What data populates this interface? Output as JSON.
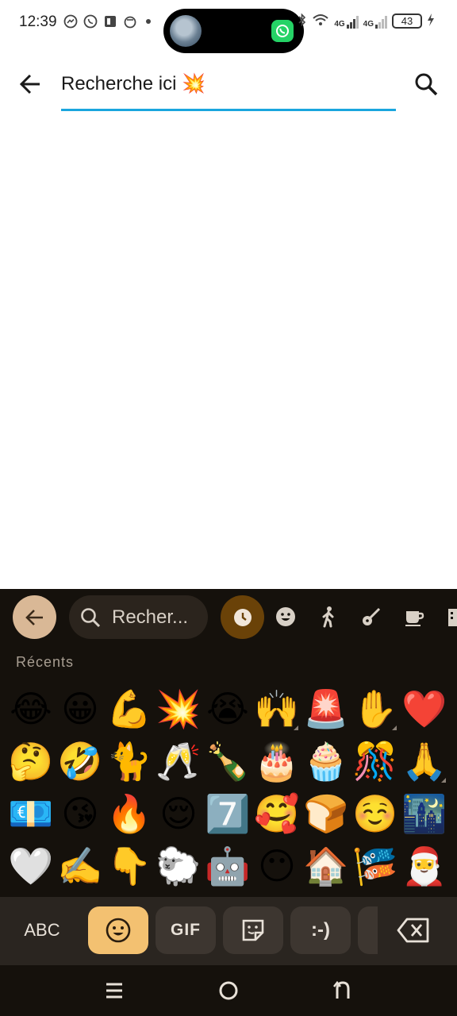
{
  "status_bar": {
    "time": "12:39",
    "battery": "43",
    "network_1": "4G",
    "network_2": "4G"
  },
  "app_bar": {
    "search_value": "Recherche ici 💥"
  },
  "keyboard": {
    "search_placeholder": "Recher...",
    "section_label": "Récents",
    "emoji_rows": [
      [
        "😂",
        "😀",
        "💪",
        "💥",
        "😭",
        "🙌",
        "🚨",
        "✋",
        "❤️"
      ],
      [
        "🤔",
        "🤣",
        "🐈",
        "🥂",
        "🍾",
        "🎂",
        "🧁",
        "🎊",
        "🙏"
      ],
      [
        "💶",
        "😘",
        "🔥",
        "😌",
        "7️⃣",
        "🥰",
        "🍞",
        "☺️",
        "🌃"
      ],
      [
        "🤍",
        "✍️",
        "👇",
        "🐑",
        "🤖",
        "😶",
        "🏠",
        "🎏",
        "🎅"
      ]
    ],
    "abc_label": "ABC",
    "gif_label": "GIF",
    "emoticon_label": ":-)"
  },
  "colors": {
    "accent": "#1aa6de",
    "keyboard_bg": "#15110c",
    "active_key": "#f3c171",
    "recent_category": "#6a4208"
  }
}
